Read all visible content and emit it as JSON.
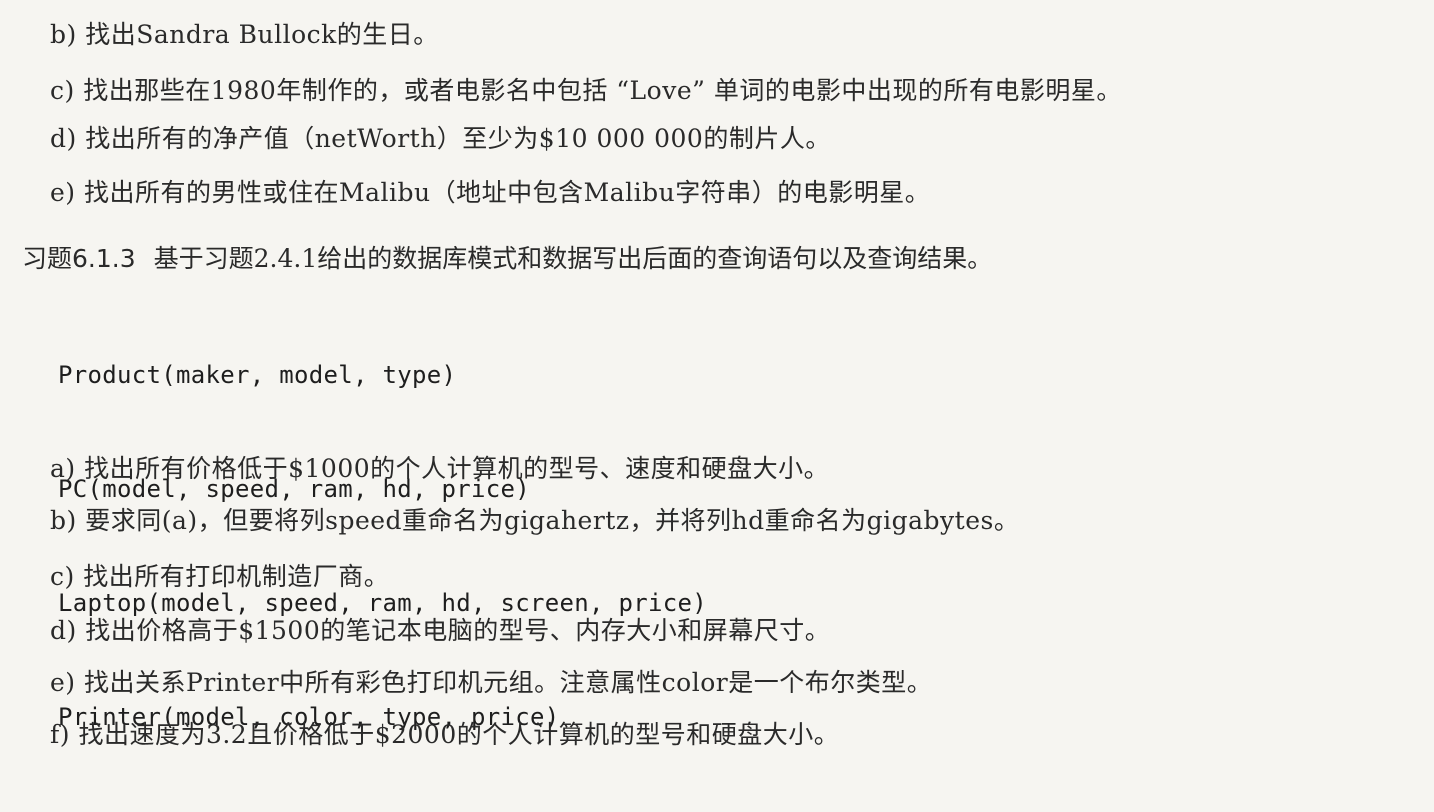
{
  "prev_questions": [
    "b) 找出Sandra Bullock的生日。",
    "c) 找出那些在1980年制作的，或者电影名中包括 “Love” 单词的电影中出现的所有电影明星。",
    "d) 找出所有的净产值（netWorth）至少为$10 000 000的制片人。",
    "e) 找出所有的男性或住在Malibu（地址中包含Malibu字符串）的电影明星。"
  ],
  "exercise": {
    "label": "习题6.1.3",
    "text": "基于习题2.4.1给出的数据库模式和数据写出后面的查询语句以及查询结果。"
  },
  "schema": [
    "Product(maker, model, type)",
    "PC(model, speed, ram, hd, price)",
    "Laptop(model, speed, ram, hd, screen, price)",
    "Printer(model, color, type, price)"
  ],
  "sub_questions": [
    "a) 找出所有价格低于$1000的个人计算机的型号、速度和硬盘大小。",
    "b) 要求同(a)，但要将列speed重命名为gigahertz，并将列hd重命名为gigabytes。",
    "c) 找出所有打印机制造厂商。",
    "d) 找出价格高于$1500的笔记本电脑的型号、内存大小和屏幕尺寸。",
    "e) 找出关系Printer中所有彩色打印机元组。注意属性color是一个布尔类型。",
    "f) 找出速度为3.2且价格低于$2000的个人计算机的型号和硬盘大小。"
  ]
}
